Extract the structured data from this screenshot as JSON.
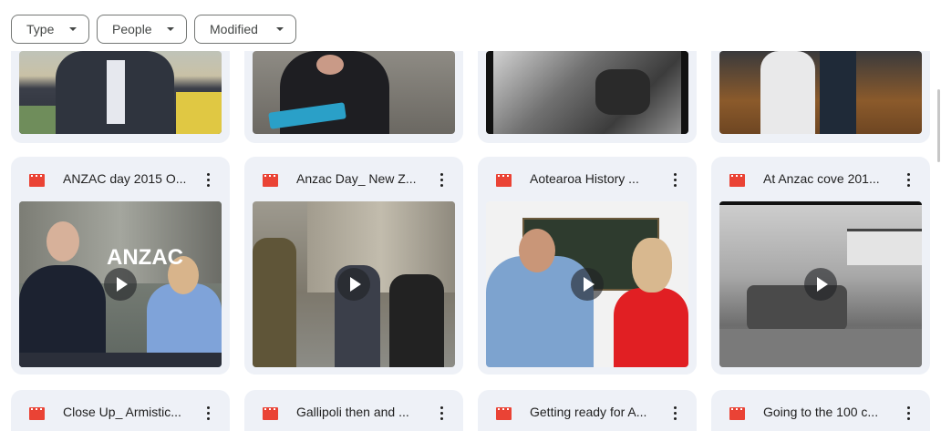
{
  "filters": [
    {
      "label": "Type"
    },
    {
      "label": "People"
    },
    {
      "label": "Modified"
    }
  ],
  "rows": [
    {
      "files": [
        {
          "title": ""
        },
        {
          "title": ""
        },
        {
          "title": ""
        },
        {
          "title": ""
        }
      ]
    },
    {
      "files": [
        {
          "title": "ANZAC day 2015 O..."
        },
        {
          "title": "Anzac Day_ New Z..."
        },
        {
          "title": "Aotearoa History ..."
        },
        {
          "title": "At Anzac cove 201..."
        }
      ]
    },
    {
      "files": [
        {
          "title": "Close Up_ Armistic..."
        },
        {
          "title": "Gallipoli then and ..."
        },
        {
          "title": "Getting ready for A..."
        },
        {
          "title": "Going to the 100 c..."
        }
      ]
    }
  ],
  "colors": {
    "accent": "#ea4335",
    "card_bg": "#eef1f7"
  },
  "icons": {
    "file_type": "video-file-icon",
    "more": "more-vert-icon",
    "play": "play-icon",
    "dropdown": "dropdown-caret-icon"
  }
}
